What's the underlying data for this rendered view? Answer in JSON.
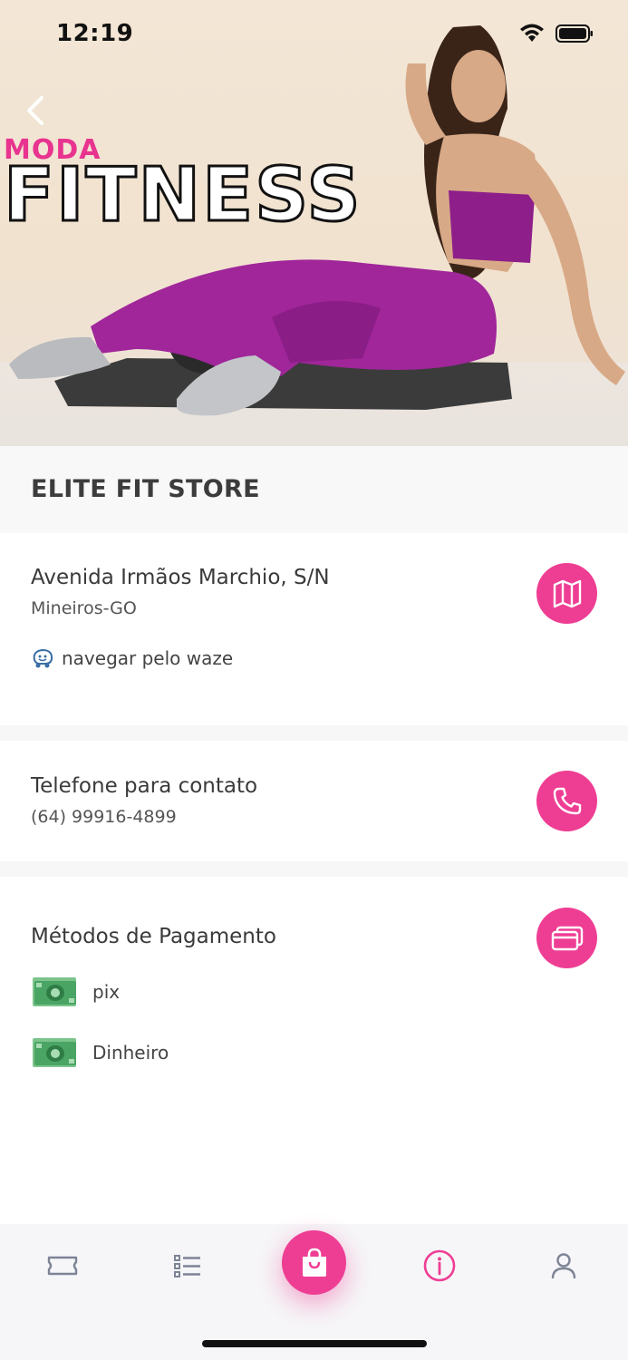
{
  "status_bar": {
    "time": "12:19"
  },
  "hero": {
    "brand_small": "MODA",
    "brand_large": "FITNESS",
    "back_icon": "chevron-left-icon"
  },
  "store": {
    "name": "ELITE FIT STORE"
  },
  "address": {
    "street": "Avenida Irmãos Marchio, S/N",
    "city": "Mineiros-GO",
    "waze_label": "navegar pelo waze",
    "map_icon": "map-icon"
  },
  "contact": {
    "title": "Telefone para contato",
    "phone": "(64) 99916-4899",
    "phone_icon": "phone-icon"
  },
  "payment": {
    "title": "Métodos de Pagamento",
    "card_icon": "credit-card-icon",
    "methods": [
      {
        "label": "pix",
        "icon": "cash-icon"
      },
      {
        "label": "Dinheiro",
        "icon": "cash-icon"
      }
    ]
  },
  "bottom_nav": {
    "items": [
      "ticket-icon",
      "list-icon",
      "shopping-bag-icon",
      "info-icon",
      "user-icon"
    ],
    "active": "info-icon"
  },
  "colors": {
    "accent": "#ee3e94",
    "cash_green": "#4aa564",
    "nav_inactive": "#7d8496"
  }
}
